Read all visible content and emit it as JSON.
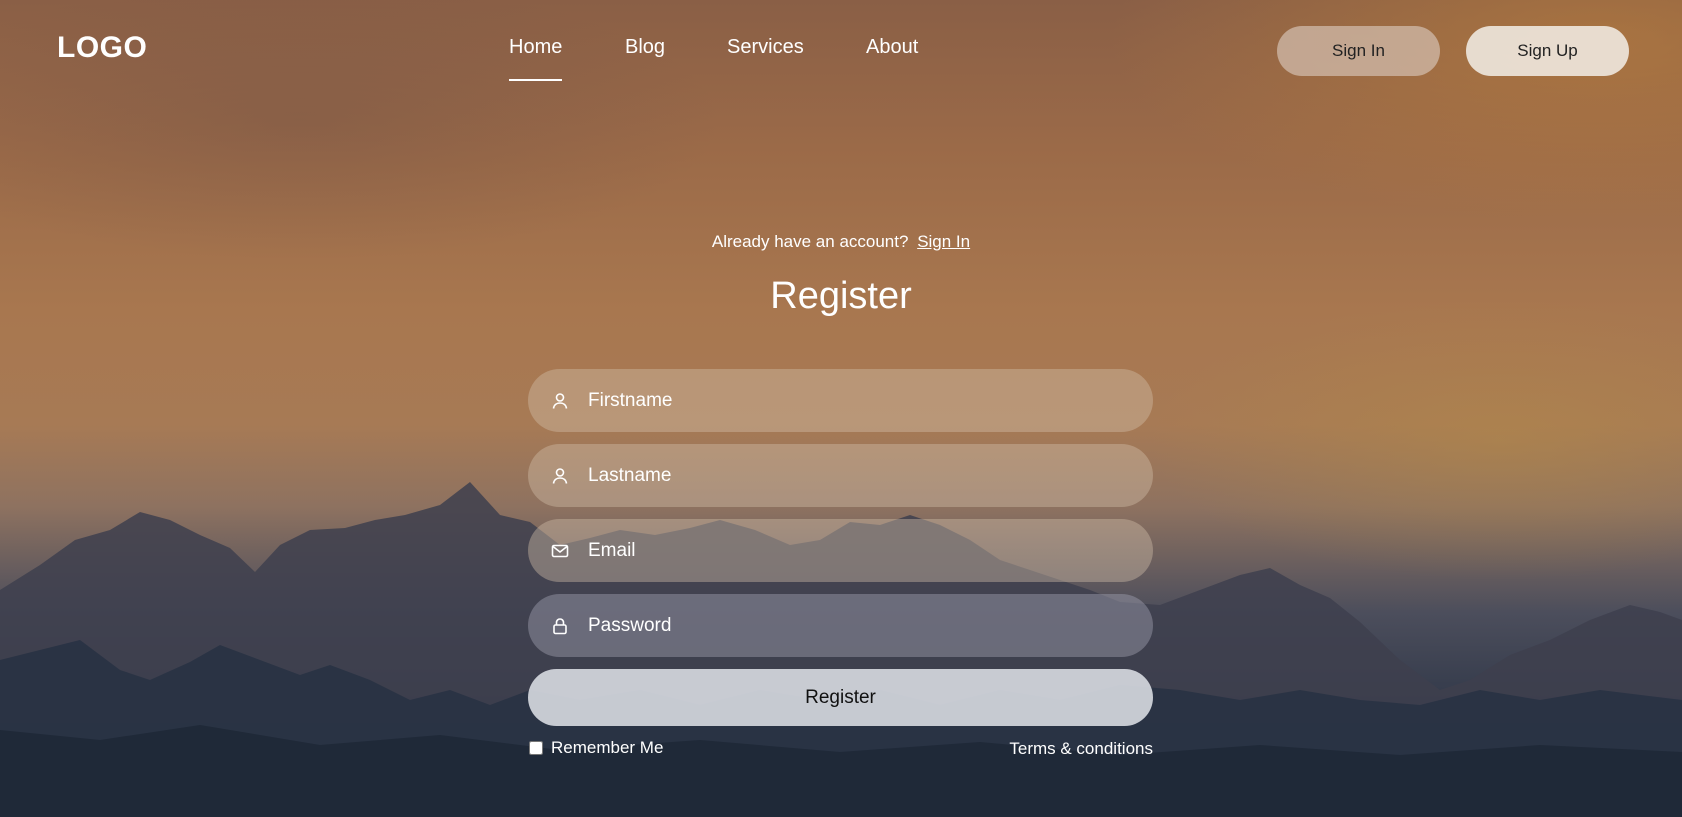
{
  "header": {
    "logo": "LOGO",
    "nav": [
      {
        "label": "Home",
        "active": true
      },
      {
        "label": "Blog",
        "active": false
      },
      {
        "label": "Services",
        "active": false
      },
      {
        "label": "About",
        "active": false
      }
    ],
    "signin_label": "Sign In",
    "signup_label": "Sign Up"
  },
  "form": {
    "account_prompt": "Already have an account?",
    "account_link": "Sign In",
    "title": "Register",
    "fields": {
      "firstname": {
        "placeholder": "Firstname",
        "icon": "user-icon"
      },
      "lastname": {
        "placeholder": "Lastname",
        "icon": "user-icon"
      },
      "email": {
        "placeholder": "Email",
        "icon": "mail-icon"
      },
      "password": {
        "placeholder": "Password",
        "icon": "lock-icon"
      }
    },
    "submit_label": "Register",
    "remember_label": "Remember Me",
    "terms_label": "Terms & conditions"
  },
  "colors": {
    "sky_top": "#8a5f46",
    "sky_mid": "#a8774f",
    "mountain_dark": "#222c3c",
    "text": "#ffffff"
  }
}
